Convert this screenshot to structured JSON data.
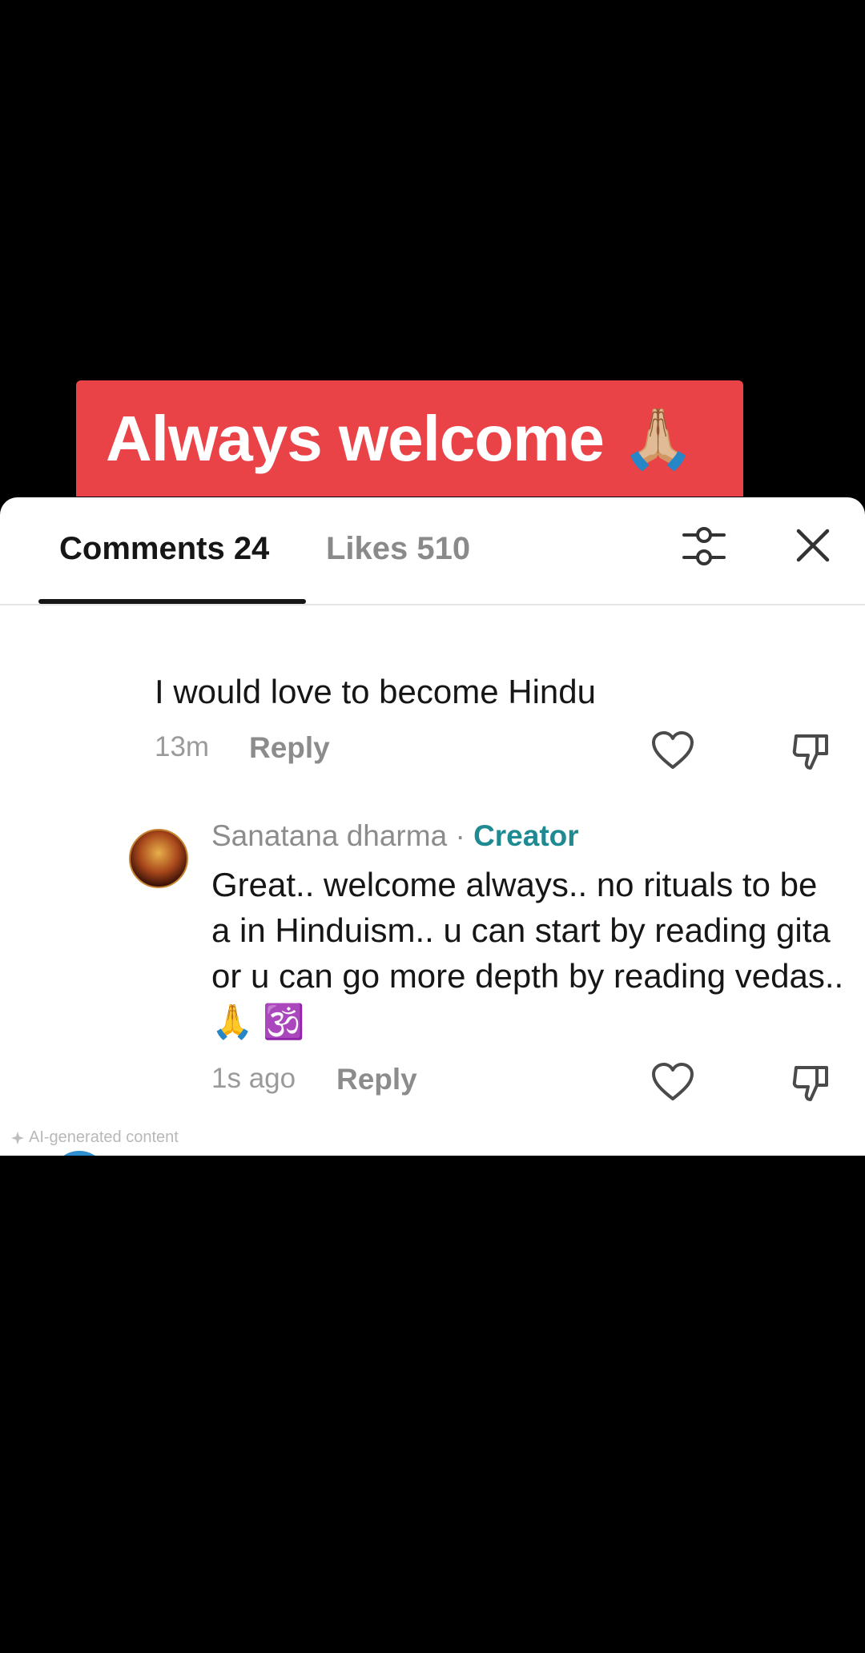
{
  "banner": {
    "text": "Always welcome",
    "emoji": "🙏🏼"
  },
  "tabs": {
    "comments": "Comments 24",
    "likes": "Likes 510"
  },
  "icons": {
    "filter": "filter-sliders-icon",
    "close": "close-icon",
    "heart": "heart-icon",
    "dislike": "thumbs-down-icon"
  },
  "comments": [
    {
      "text": "I would love to become Hindu",
      "time": "13m",
      "reply_label": "Reply"
    }
  ],
  "reply": {
    "author": "Sanatana dharma",
    "separator": " · ",
    "badge": "Creator",
    "text": "Great.. welcome always.. no rituals to be a in Hinduism.. u can start by reading gita or u can go more depth by reading vedas.. 🙏 🕉️",
    "time": "1s ago",
    "reply_label": "Reply"
  },
  "footer": {
    "ai_label": "AI-generated content"
  },
  "colors": {
    "banner": "#e94348",
    "creator_badge": "#1f8a91",
    "background": "#000000"
  }
}
